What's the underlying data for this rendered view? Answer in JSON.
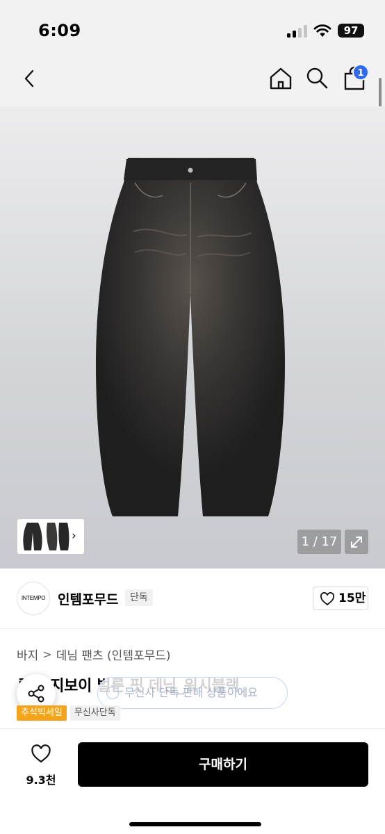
{
  "status_bar": {
    "time": "6:09",
    "battery": "97"
  },
  "nav": {
    "back_icon": "chevron-left-icon",
    "home_icon": "home-icon",
    "search_icon": "search-icon",
    "cart_icon": "shopping-bag-icon",
    "cart_badge": "1"
  },
  "gallery": {
    "counter": "1 / 17",
    "thumb_chevron": "›",
    "expand_icon": "expand-icon"
  },
  "brand": {
    "logo_text": "INTEMPO",
    "name": "인템포무드",
    "tag": "단독",
    "likes": "15만"
  },
  "breadcrumb": {
    "items": [
      "바지",
      "데님 팬츠 (인템포무드)"
    ],
    "separator": ">"
  },
  "product": {
    "title": "루즈 지보이 벌룬 핏 데님_워시블랙",
    "toast": "무신사 단독 판매 상품이에요",
    "tags": [
      "추석빅세일",
      "무신사단독"
    ]
  },
  "bottom": {
    "wish_count": "9.3천",
    "buy_label": "구매하기"
  },
  "colors": {
    "accent_blue": "#2f6bf0",
    "sale_orange": "#f5a31a",
    "buy_black": "#000000"
  }
}
